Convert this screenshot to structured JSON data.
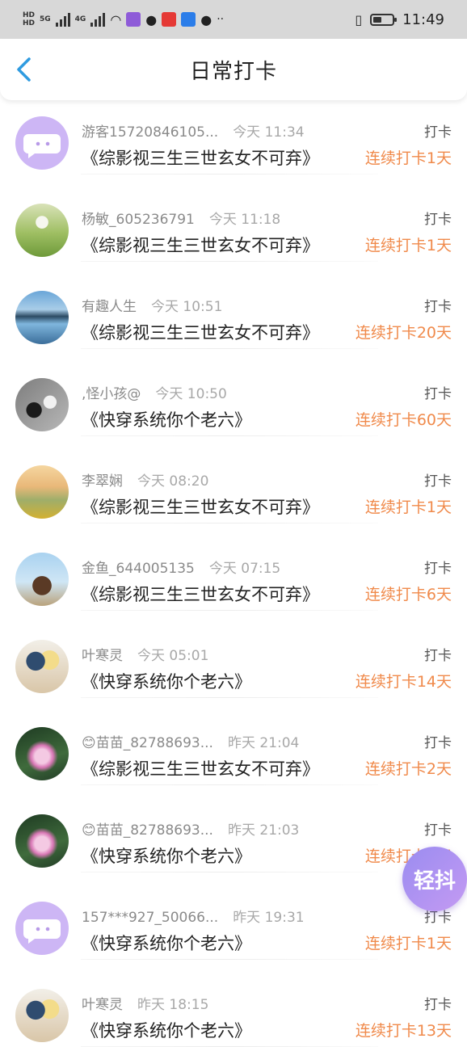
{
  "status_bar": {
    "hd1": "HD",
    "hd2": "HD",
    "net1": "5G",
    "net2": "4G",
    "extra": "··",
    "time": "11:49"
  },
  "header": {
    "title": "日常打卡",
    "back_icon": "chevron-left-icon"
  },
  "checkins": [
    {
      "user": "游客15720846105...",
      "time": "今天 11:34",
      "book": "《综影视三生三世玄女不可弃》",
      "action": "打卡",
      "streak": "连续打卡1天",
      "avatar": "purple-chat"
    },
    {
      "user": "杨敏_605236791",
      "time": "今天 11:18",
      "book": "《综影视三生三世玄女不可弃》",
      "action": "打卡",
      "streak": "连续打卡1天",
      "avatar": "meadow"
    },
    {
      "user": "有趣人生",
      "time": "今天 10:51",
      "book": "《综影视三生三世玄女不可弃》",
      "action": "打卡",
      "streak": "连续打卡20天",
      "avatar": "lake"
    },
    {
      "user": ",怪小孩@",
      "time": "今天 10:50",
      "book": "《快穿系统你个老六》",
      "action": "打卡",
      "streak": "连续打卡60天",
      "avatar": "shoes"
    },
    {
      "user": "李翠娴",
      "time": "今天 08:20",
      "book": "《综影视三生三世玄女不可弃》",
      "action": "打卡",
      "streak": "连续打卡1天",
      "avatar": "sunset"
    },
    {
      "user": "金鱼_644005135",
      "time": "今天 07:15",
      "book": "《综影视三生三世玄女不可弃》",
      "action": "打卡",
      "streak": "连续打卡6天",
      "avatar": "horse"
    },
    {
      "user": "叶寒灵",
      "time": "今天 05:01",
      "book": "《快穿系统你个老六》",
      "action": "打卡",
      "streak": "连续打卡14天",
      "avatar": "anime"
    },
    {
      "user": "😊苗苗_82788693...",
      "time": "昨天 21:04",
      "book": "《综影视三生三世玄女不可弃》",
      "action": "打卡",
      "streak": "连续打卡2天",
      "avatar": "lotus"
    },
    {
      "user": "😊苗苗_82788693...",
      "time": "昨天 21:03",
      "book": "《快穿系统你个老六》",
      "action": "打卡",
      "streak": "连续打卡2天",
      "avatar": "lotus"
    },
    {
      "user": "157***927_50066...",
      "time": "昨天 19:31",
      "book": "《快穿系统你个老六》",
      "action": "打卡",
      "streak": "连续打卡1天",
      "avatar": "purple-chat"
    },
    {
      "user": "叶寒灵",
      "time": "昨天 18:15",
      "book": "《快穿系统你个老六》",
      "action": "打卡",
      "streak": "连续打卡13天",
      "avatar": "anime"
    }
  ],
  "floating_button": {
    "label": "轻抖"
  }
}
